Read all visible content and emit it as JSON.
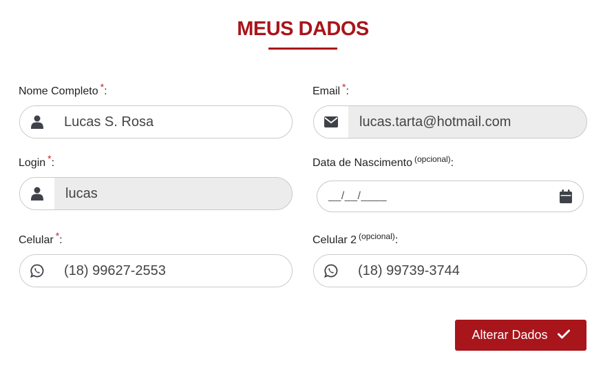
{
  "page": {
    "title": "MEUS DADOS"
  },
  "required_mark": "*",
  "optional_mark": "(opcional)",
  "fields": {
    "nome": {
      "label": "Nome Completo",
      "value": "Lucas S. Rosa"
    },
    "email": {
      "label": "Email",
      "value": "lucas.tarta@hotmail.com"
    },
    "login": {
      "label": "Login",
      "value": "lucas"
    },
    "nascimento": {
      "label": "Data de Nascimento",
      "placeholder": "__/__/____"
    },
    "celular": {
      "label": "Celular",
      "value": "(18) 99627-2553"
    },
    "celular2": {
      "label": "Celular 2",
      "value": "(18) 99739-3744"
    }
  },
  "colon": ":",
  "submit": {
    "label": "Alterar Dados"
  },
  "colors": {
    "accent": "#a8151b",
    "required": "#c8232b",
    "readonly_bg": "#ececec",
    "icon": "#3f4248"
  },
  "icons": {
    "nome": "user-icon",
    "email": "envelope-icon",
    "login": "user-icon",
    "nascimento": "calendar-icon",
    "celular": "whatsapp-icon",
    "celular2": "whatsapp-icon",
    "submit": "checkmark-icon"
  }
}
